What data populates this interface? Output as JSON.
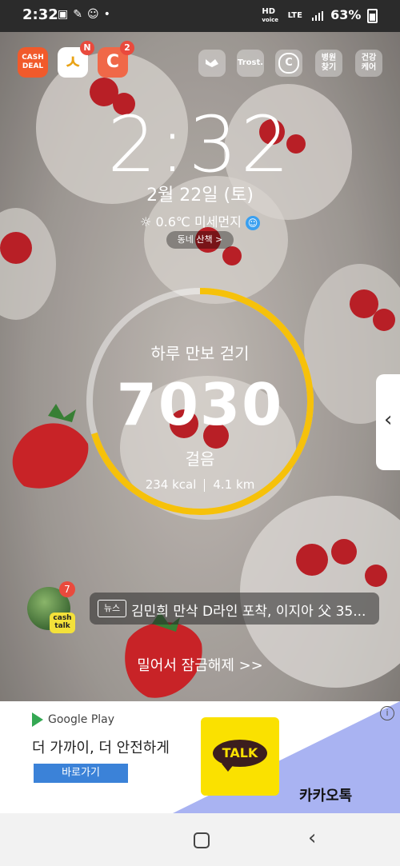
{
  "status_bar": {
    "time": "2:32",
    "battery": "63%",
    "network_top": "HD",
    "network_sub": "voice",
    "lte": "LTE"
  },
  "top_apps": [
    {
      "label": "CASH DEAL",
      "badge": ""
    },
    {
      "label": "ㅅ",
      "badge": "N"
    },
    {
      "label": "C",
      "badge": "2"
    }
  ],
  "right_icons": [
    "Trost.",
    "병원찾기",
    "건강케어"
  ],
  "lockscreen": {
    "time": "2:32",
    "date": "2월 22일 (토)",
    "weather": "0.6℃ 미세먼지",
    "walk_button": "동네 산책 >"
  },
  "steps_widget": {
    "label": "하루 만보 걷기",
    "steps": "7030",
    "unit": "걸음",
    "kcal": "234 kcal",
    "distance": "4.1 km",
    "progress": 0.703
  },
  "news": {
    "badge": "7",
    "app_label": "cash talk",
    "tag": "뉴스",
    "headline": "김민희 만삭 D라인 포착, 이지아 父 35..."
  },
  "unlock_text": "밀어서 잠금해제 >>",
  "ad": {
    "store": "Google Play",
    "headline": "더 가까이, 더 안전하게",
    "button": "바로가기",
    "logo_text": "TALK",
    "brand": "카카오톡",
    "info": "i"
  },
  "colors": {
    "accent_ring": "#f6c10a",
    "badge": "#e94a3d",
    "kakao": "#fae100"
  }
}
